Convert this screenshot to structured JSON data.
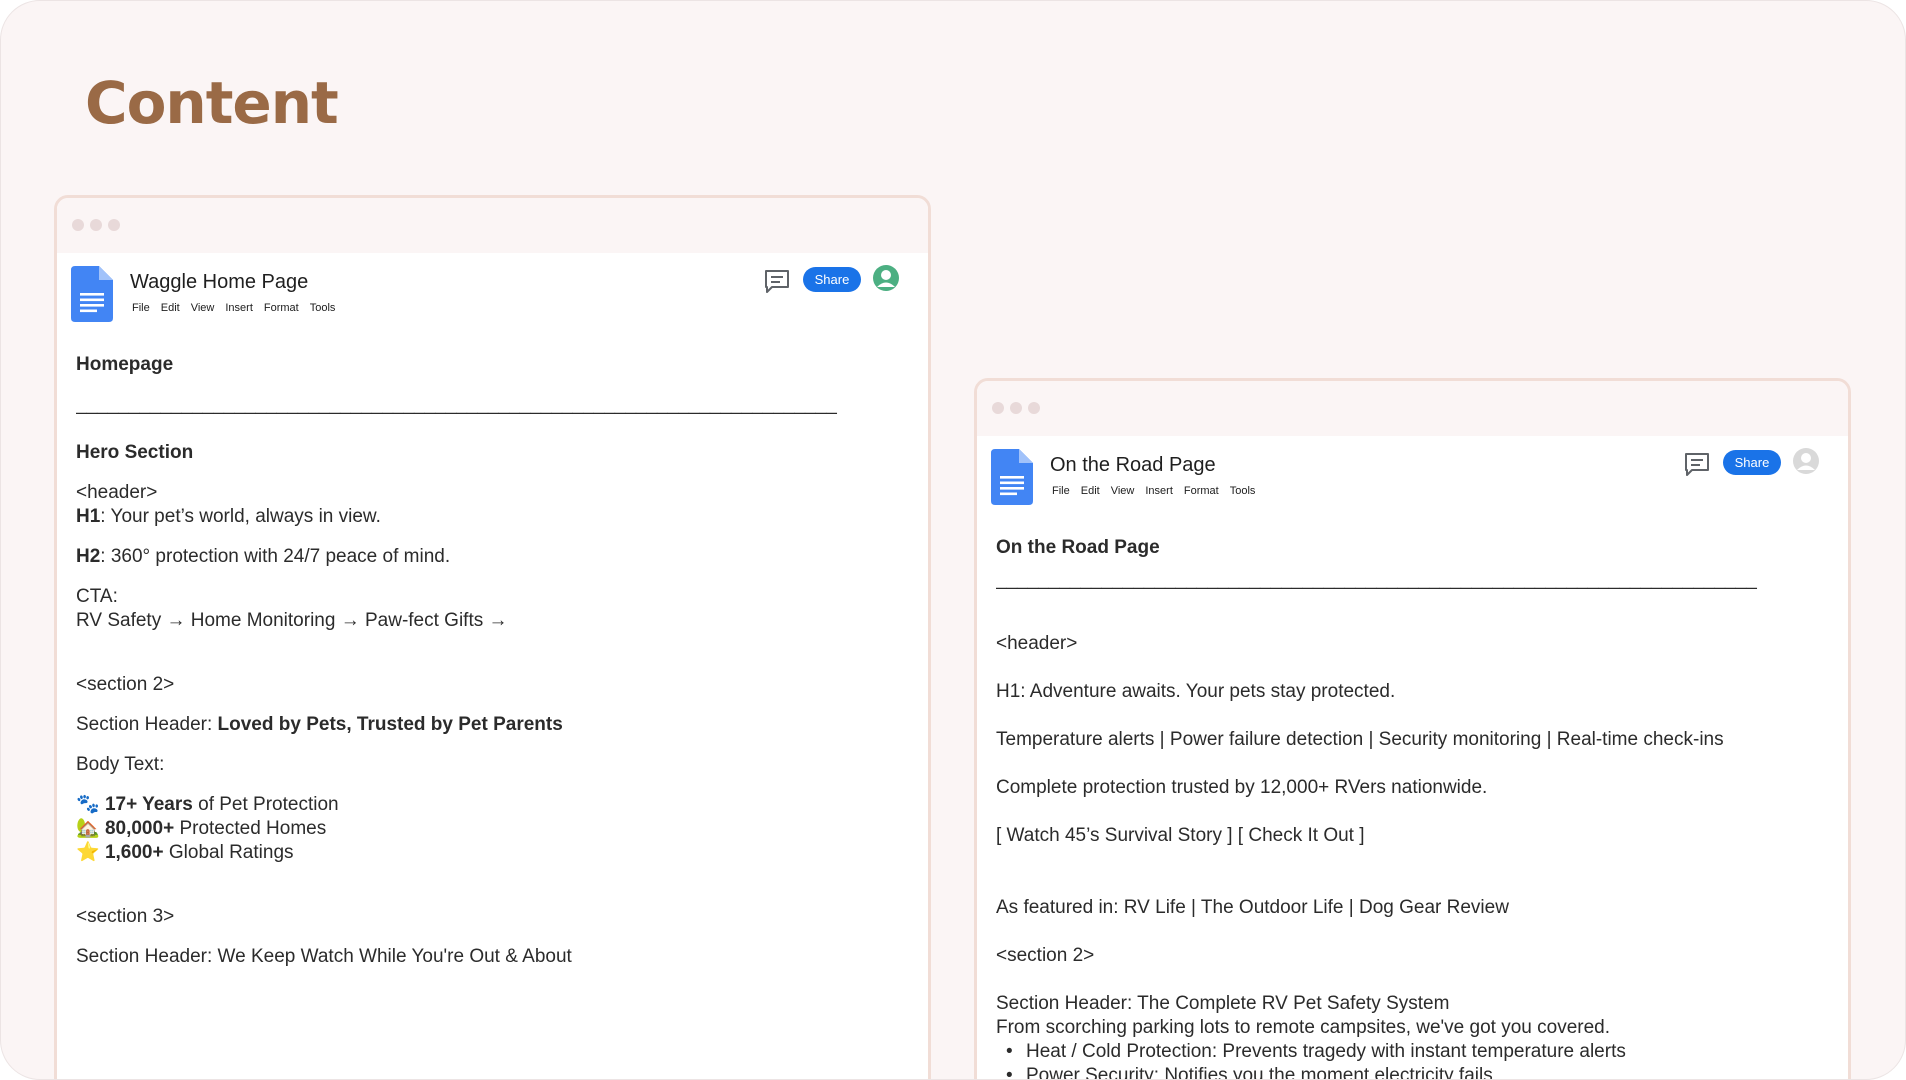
{
  "page": {
    "title": "Content"
  },
  "doc1": {
    "name": "Waggle Home Page",
    "menu": [
      "File",
      "Edit",
      "View",
      "Insert",
      "Format",
      "Tools"
    ],
    "share_label": "Share",
    "heading": "Homepage",
    "rule": "________________________________________________________________________",
    "hero_heading": "Hero Section",
    "header_tag": "<header>",
    "h1_label": "H1",
    "h1_text": ": Your pet’s world, always in view.",
    "h2_label": "H2",
    "h2_text": ": 360° protection with 24/7 peace of mind.",
    "cta_label": "CTA:",
    "cta_text": "RV Safety → Home Monitoring → Paw-fect Gifts →",
    "section2_tag": "<section 2>",
    "section2_header_label": "Section Header: ",
    "section2_header_text": "Loved by Pets, Trusted by Pet Parents",
    "body_text_label": "Body Text:",
    "stats": [
      {
        "emoji": "🐾",
        "bold": "17+ Years",
        "rest": " of Pet Protection"
      },
      {
        "emoji": "🏡",
        "bold": "80,000+",
        "rest": " Protected Homes"
      },
      {
        "emoji": "⭐",
        "bold": "1,600+",
        "rest": " Global Ratings"
      }
    ],
    "section3_tag": "<section 3>",
    "section3_header": "Section Header: We Keep Watch While You're Out & About"
  },
  "doc2": {
    "name": "On the Road Page",
    "menu": [
      "File",
      "Edit",
      "View",
      "Insert",
      "Format",
      "Tools"
    ],
    "share_label": "Share",
    "heading": "On the Road Page",
    "rule": "________________________________________________________________________",
    "header_tag": "<header>",
    "h1_line": "H1: Adventure awaits. Your pets stay protected.",
    "features_line": "Temperature alerts | Power failure detection | Security monitoring | Real-time check-ins",
    "trust_line": "Complete protection trusted by 12,000+ RVers nationwide.",
    "cta_line": "[ Watch 45’s Survival Story ] [ Check It Out ]",
    "featured_line": "As featured in: RV Life | The Outdoor Life | Dog Gear Review",
    "section2_tag": "<section 2>",
    "section2_header": "Section Header: The Complete RV Pet Safety System",
    "section2_intro": "From scorching parking lots to remote campsites, we've got you covered.",
    "bullets": [
      "Heat / Cold Protection: Prevents tragedy with instant temperature alerts",
      "Power Security: Notifies you the moment electricity fails"
    ]
  },
  "colors": {
    "title": "#9a6a46",
    "share_button": "#1a73e8",
    "avatar_active": "#4caf82",
    "avatar_inactive": "#d9d9d9",
    "doc_icon": "#4285f4"
  },
  "icons": [
    "google-docs-icon",
    "comment-icon",
    "account-icon"
  ]
}
